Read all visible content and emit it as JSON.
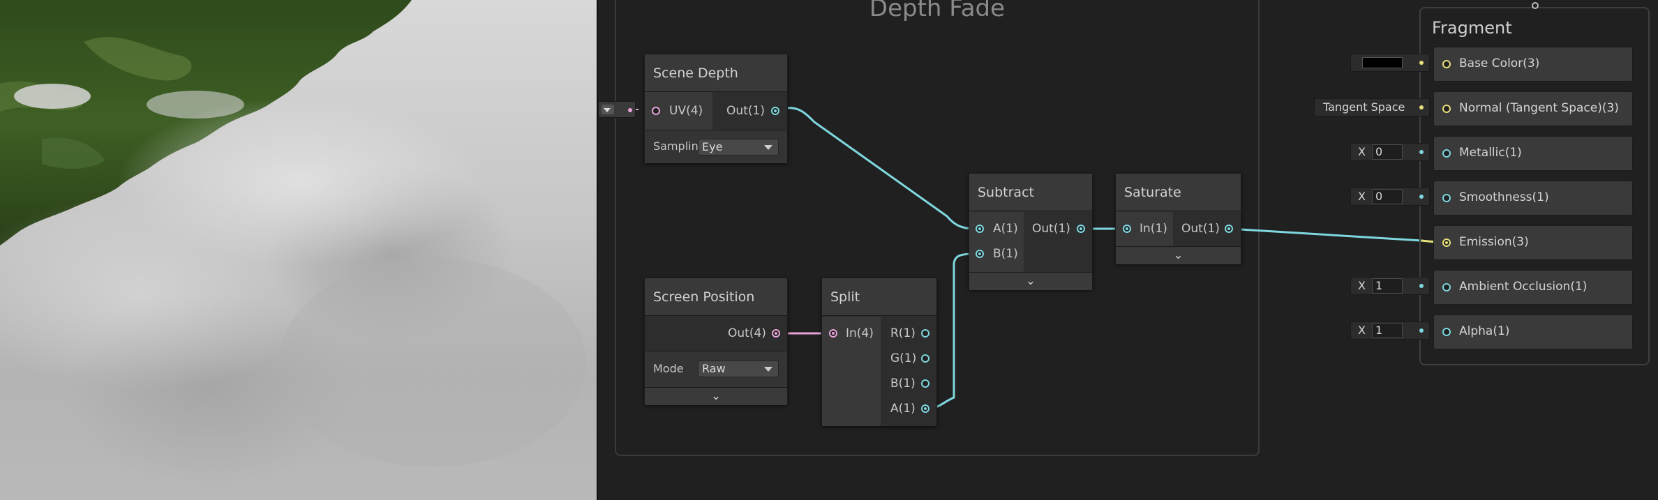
{
  "group": {
    "title": "Depth Fade"
  },
  "nodes": {
    "scene_depth": {
      "title": "Scene Depth",
      "input": "UV(4)",
      "output": "Out(1)",
      "sampling_label": "Samplin",
      "sampling_value": "Eye"
    },
    "screen_position": {
      "title": "Screen Position",
      "output": "Out(4)",
      "mode_label": "Mode",
      "mode_value": "Raw"
    },
    "split": {
      "title": "Split",
      "input": "In(4)",
      "outputs": [
        "R(1)",
        "G(1)",
        "B(1)",
        "A(1)"
      ]
    },
    "subtract": {
      "title": "Subtract",
      "inputs": [
        "A(1)",
        "B(1)"
      ],
      "output": "Out(1)"
    },
    "saturate": {
      "title": "Saturate",
      "input": "In(1)",
      "output": "Out(1)"
    }
  },
  "fragment": {
    "title": "Fragment",
    "blocks": [
      {
        "label": "Base Color(3)",
        "field": "swatch",
        "swatch_color": "#000000"
      },
      {
        "label": "Normal (Tangent Space)(3)",
        "field_text": "Tangent Space"
      },
      {
        "label": "Metallic(1)",
        "axis": "X",
        "value": "0"
      },
      {
        "label": "Smoothness(1)",
        "axis": "X",
        "value": "0"
      },
      {
        "label": "Emission(3)"
      },
      {
        "label": "Ambient Occlusion(1)",
        "axis": "X",
        "value": "1"
      },
      {
        "label": "Alpha(1)",
        "axis": "X",
        "value": "1"
      }
    ]
  },
  "colors": {
    "float_port": "#7fd8e0",
    "vector4_port": "#e8a4d8",
    "vector3_port": "#e8e07a",
    "graph_background": "#202020"
  },
  "icons": [
    "chevron-down-icon",
    "dropdown-caret-icon"
  ]
}
